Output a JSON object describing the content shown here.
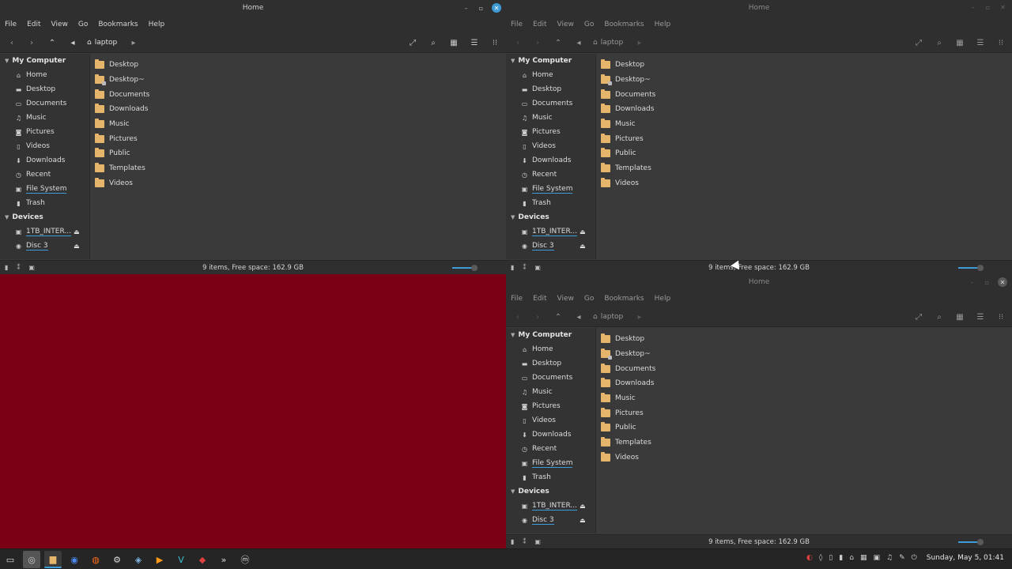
{
  "window_title": "Home",
  "menu": [
    "File",
    "Edit",
    "View",
    "Go",
    "Bookmarks",
    "Help"
  ],
  "location": "laptop",
  "sidebar": {
    "my_computer": "My Computer",
    "places": [
      {
        "label": "Home",
        "icon": "home-icon"
      },
      {
        "label": "Desktop",
        "icon": "desktop-icon"
      },
      {
        "label": "Documents",
        "icon": "documents-icon"
      },
      {
        "label": "Music",
        "icon": "music-icon"
      },
      {
        "label": "Pictures",
        "icon": "pictures-icon"
      },
      {
        "label": "Videos",
        "icon": "videos-icon"
      },
      {
        "label": "Downloads",
        "icon": "downloads-icon"
      },
      {
        "label": "Recent",
        "icon": "recent-icon"
      },
      {
        "label": "File System",
        "icon": "drive-icon"
      },
      {
        "label": "Trash",
        "icon": "trash-icon"
      }
    ],
    "devices_header": "Devices",
    "devices": [
      {
        "label": "1TB_INTER...",
        "icon": "drive-icon"
      },
      {
        "label": "Disc 3",
        "icon": "disc-icon"
      }
    ]
  },
  "sidebar_top_right": {
    "places": [
      {
        "label": "Home",
        "icon": "home-icon"
      },
      {
        "label": "Desktop",
        "icon": "desktop-icon"
      },
      {
        "label": "Documents",
        "icon": "documents-icon"
      },
      {
        "label": "Music",
        "icon": "music-icon"
      },
      {
        "label": "Pictures",
        "icon": "pictures-icon"
      },
      {
        "label": "Videos",
        "icon": "videos-icon"
      },
      {
        "label": "Downloads",
        "icon": "downloads-icon"
      },
      {
        "label": "Recent",
        "icon": "recent-icon"
      },
      {
        "label": "File System",
        "icon": "drive-icon"
      },
      {
        "label": "Trash",
        "icon": "trash-icon"
      }
    ]
  },
  "files": [
    "Desktop",
    "Desktop~",
    "Documents",
    "Downloads",
    "Music",
    "Pictures",
    "Public",
    "Templates",
    "Videos"
  ],
  "status": "9 items, Free space: 162.9 GB",
  "clock": "Sunday, May 5, 01:41",
  "colors": {
    "accent": "#3d9bd6",
    "folder": "#e4b56a",
    "desktop_bg": "#7b0015"
  }
}
